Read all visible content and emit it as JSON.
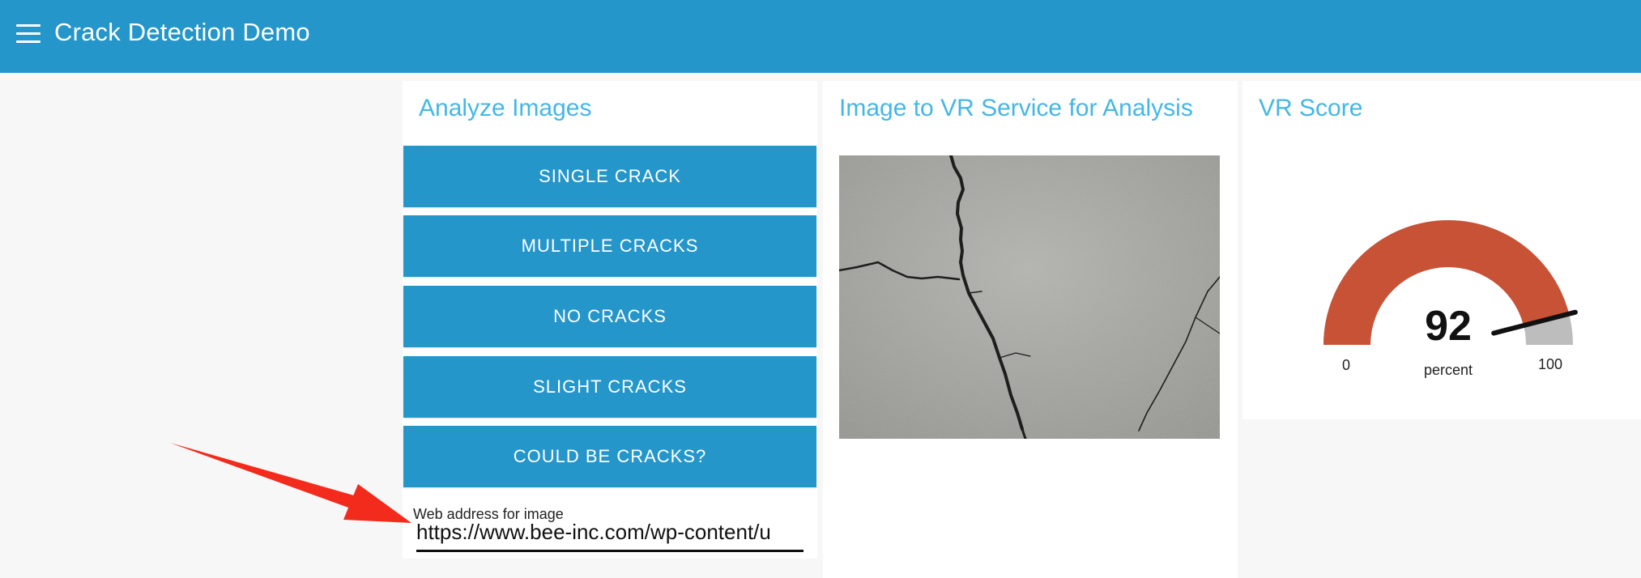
{
  "header": {
    "title": "Crack Detection Demo",
    "menu_icon": "hamburger-menu-icon",
    "background": "#2496ca"
  },
  "analyze": {
    "title": "Analyze Images",
    "buttons": [
      "SINGLE CRACK",
      "MULTIPLE CRACKS",
      "NO CRACKS",
      "SLIGHT CRACKS",
      "COULD BE CRACKS?"
    ],
    "url_label": "Web address for image",
    "url_value": "https://www.bee-inc.com/wp-content/u"
  },
  "image_card": {
    "title": "Image to VR Service for Analysis",
    "image_description": "cracked-concrete-photo"
  },
  "score": {
    "title": "VR Score",
    "value": "92",
    "unit": "percent",
    "min": "0",
    "max": "100",
    "fill_color": "#c75236",
    "track_color": "#bdbdbd"
  },
  "colors": {
    "accent": "#2496ca",
    "title_text": "#44b7e6",
    "annotation_arrow": "#f22b1d"
  }
}
